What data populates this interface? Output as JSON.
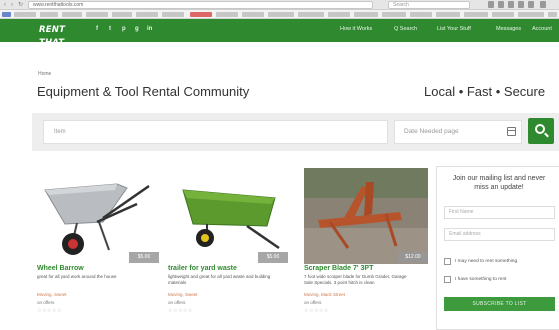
{
  "browser": {
    "back": "‹",
    "forward": "›",
    "reload": "↻",
    "url": "www.rentthattools.com",
    "search_placeholder": "Search"
  },
  "header": {
    "logo": "RENT THAT TOOLS",
    "social": [
      "f",
      "t",
      "p",
      "g",
      "in"
    ],
    "nav": [
      "How it Works",
      "Q Search",
      "List Your Stuff",
      "Messages",
      "Account"
    ],
    "brand_color": "#2f8a2f"
  },
  "breadcrumb": "Home",
  "page": {
    "title": "Equipment & Tool Rental Community",
    "tagline": "Local • Fast • Secure"
  },
  "search": {
    "item_placeholder": "Item",
    "date_placeholder": "Date Needed page",
    "calendar_icon": "calendar-icon",
    "button_icon": "search-icon"
  },
  "listings": [
    {
      "title": "Wheel Barrow",
      "description": "great for all yard work around the house",
      "location": "Moving, Sweet",
      "meta": "on offers",
      "price": "$5.00",
      "stars": "☆☆☆☆☆"
    },
    {
      "title": "trailer for yard waste",
      "description": "lightweight and great for all yard waste and building materials",
      "location": "Moving, Sweet",
      "meta": "on offers",
      "price": "$5.00",
      "stars": "☆☆☆☆☆"
    },
    {
      "title": "Scraper Blade 7' 3PT",
      "description": "7 foot wide scraper blade for Dumb Grader, Garage Sale Specials. 3 point hitch is clean",
      "location": "Moving, Mack Street",
      "meta": "on offers",
      "price": "$12.00",
      "stars": "☆☆☆☆☆"
    }
  ],
  "mailing": {
    "heading": "Join our mailing list and never miss an update!",
    "first_name": "First Name",
    "email": "Email address",
    "option_rent": "I may need to rent something",
    "option_list": "I have something to rent",
    "button": "SUBSCRIBE TO LIST"
  }
}
